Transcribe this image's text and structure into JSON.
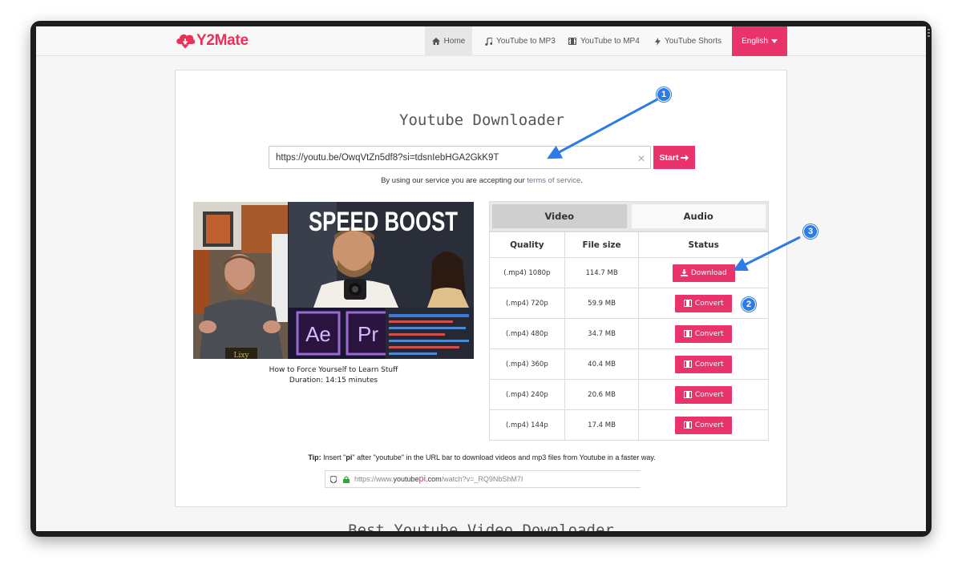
{
  "nav": {
    "logo": "Y2Mate",
    "items": [
      {
        "label": "Home",
        "icon": "home-icon"
      },
      {
        "label": "YouTube to MP3",
        "icon": "music-note-icon"
      },
      {
        "label": "YouTube to MP4",
        "icon": "film-icon"
      },
      {
        "label": "YouTube Shorts",
        "icon": "lightning-icon"
      }
    ],
    "language": "English"
  },
  "main": {
    "title": "Youtube Downloader",
    "url_value": "https://youtu.be/OwqVtZn5df8?si=tdsnIebHGA2GkK9T",
    "start_label": "Start",
    "terms_prefix": "By using our service you are accepting our ",
    "terms_link": "terms of service",
    "terms_suffix": "."
  },
  "video": {
    "thumb_text": "SPEED BOOST",
    "thumb_logo_ae": "Ae",
    "thumb_logo_pr": "Pr",
    "thumb_mug": "Lixy",
    "title": "How to Force Yourself to Learn Stuff",
    "duration": "Duration: 14:15 minutes"
  },
  "tabs": {
    "video": "Video",
    "audio": "Audio"
  },
  "table": {
    "headers": {
      "quality": "Quality",
      "size": "File size",
      "status": "Status"
    },
    "rows": [
      {
        "quality": "(.mp4) 1080p",
        "size": "114.7 MB",
        "action": "Download"
      },
      {
        "quality": "(.mp4) 720p",
        "size": "59.9 MB",
        "action": "Convert"
      },
      {
        "quality": "(.mp4) 480p",
        "size": "34.7 MB",
        "action": "Convert"
      },
      {
        "quality": "(.mp4) 360p",
        "size": "40.4 MB",
        "action": "Convert"
      },
      {
        "quality": "(.mp4) 240p",
        "size": "20.6 MB",
        "action": "Convert"
      },
      {
        "quality": "(.mp4) 144p",
        "size": "17.4 MB",
        "action": "Convert"
      }
    ]
  },
  "tip": {
    "label": "Tip:",
    "text_before": " Insert \"",
    "highlight": "pi",
    "text_after": "\" after \"youtube\" in the URL bar to download videos and mp3 files from Youtube in a faster way.",
    "url_prefix": "https://www.",
    "url_domain": "youtube",
    "url_pi": "pi",
    "url_rest": ".com",
    "url_path": "/watch?v=_RQ9NbShM7I"
  },
  "footer_heading": "Best Youtube Video Downloader",
  "markers": [
    "1",
    "2",
    "3"
  ],
  "colors": {
    "accent": "#e8336b",
    "annotation": "#2d7be6"
  }
}
